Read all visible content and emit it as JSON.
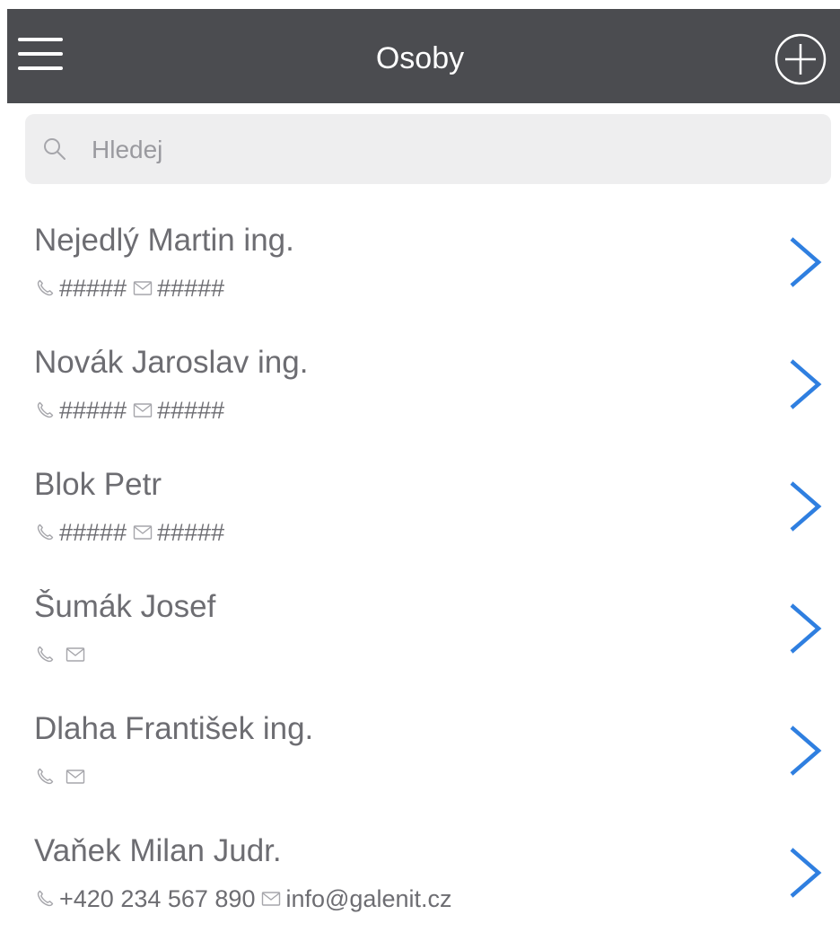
{
  "navbar": {
    "title": "Osoby",
    "menu_icon": "hamburger-menu-icon",
    "add_icon": "plus-circle-icon",
    "background": "#4b4c50"
  },
  "search": {
    "placeholder": "Hledej",
    "value": "",
    "icon": "search-icon"
  },
  "accent_color": "#2f7fe0",
  "people": [
    {
      "name": "Nejedlý Martin ing.",
      "phone": "#####",
      "email": "#####"
    },
    {
      "name": "Novák Jaroslav ing.",
      "phone": "#####",
      "email": "#####"
    },
    {
      "name": "Blok Petr",
      "phone": "#####",
      "email": "#####"
    },
    {
      "name": "Šumák Josef",
      "phone": "",
      "email": ""
    },
    {
      "name": "Dlaha František ing.",
      "phone": "",
      "email": ""
    },
    {
      "name": "Vaňek Milan Judr.",
      "phone": "+420 234 567 890",
      "email": "info@galenit.cz"
    }
  ]
}
